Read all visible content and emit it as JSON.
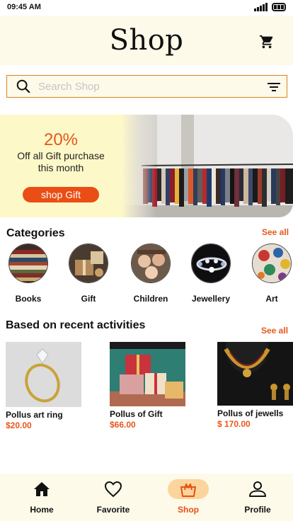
{
  "status_bar": {
    "time": "09:45 AM"
  },
  "header": {
    "title": "Shop"
  },
  "search": {
    "placeholder": "Search Shop",
    "value": ""
  },
  "banner": {
    "percent": "20%",
    "line1": "Off all Gift purchase",
    "line2": "this month",
    "button_label": "shop Gift"
  },
  "categories": {
    "title": "Categories",
    "see_all": "See all",
    "items": [
      {
        "label": "Books",
        "icon": "books-photo"
      },
      {
        "label": "Gift",
        "icon": "gift-photo"
      },
      {
        "label": "Children",
        "icon": "children-photo"
      },
      {
        "label": "Jewellery",
        "icon": "jewellery-photo"
      },
      {
        "label": "Art",
        "icon": "art-photo"
      }
    ]
  },
  "recent": {
    "title": "Based on recent activities",
    "see_all": "See all",
    "products": [
      {
        "name": "Pollus art ring",
        "price": "$20.00"
      },
      {
        "name": "Pollus of Gift",
        "price": "$66.00"
      },
      {
        "name": "Pollus of jewells",
        "price": "$ 170.00"
      }
    ]
  },
  "tabbar": {
    "items": [
      {
        "label": "Home",
        "icon": "home-icon"
      },
      {
        "label": "Favorite",
        "icon": "heart-icon"
      },
      {
        "label": "Shop",
        "icon": "shopping-bag-icon",
        "active": true
      },
      {
        "label": "Profile",
        "icon": "profile-icon"
      }
    ]
  },
  "colors": {
    "accent": "#e8561a",
    "header_bg": "#fdfaea",
    "banner_bg": "#fdf8c8",
    "active_tab_bg": "#fbd59b"
  }
}
